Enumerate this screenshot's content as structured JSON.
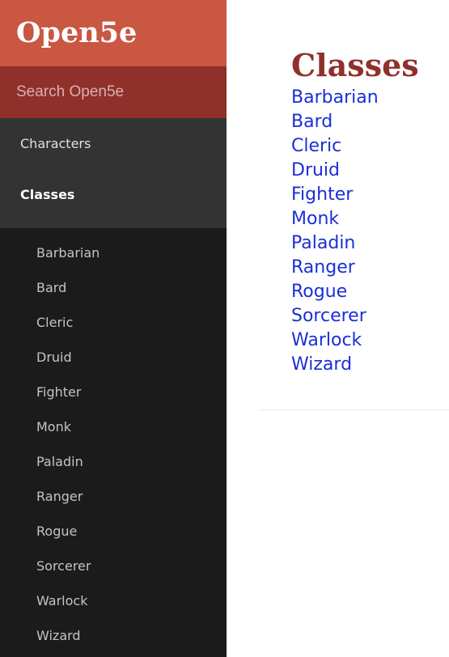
{
  "brand": {
    "title": "Open5e"
  },
  "search": {
    "placeholder": "Search Open5e"
  },
  "nav": {
    "top_items": [
      {
        "label": "Characters"
      },
      {
        "label": "Classes"
      }
    ],
    "sub_items": [
      {
        "label": "Barbarian"
      },
      {
        "label": "Bard"
      },
      {
        "label": "Cleric"
      },
      {
        "label": "Druid"
      },
      {
        "label": "Fighter"
      },
      {
        "label": "Monk"
      },
      {
        "label": "Paladin"
      },
      {
        "label": "Ranger"
      },
      {
        "label": "Rogue"
      },
      {
        "label": "Sorcerer"
      },
      {
        "label": "Warlock"
      },
      {
        "label": "Wizard"
      }
    ]
  },
  "main": {
    "title": "Classes",
    "links": [
      {
        "label": "Barbarian"
      },
      {
        "label": "Bard"
      },
      {
        "label": "Cleric"
      },
      {
        "label": "Druid"
      },
      {
        "label": "Fighter"
      },
      {
        "label": "Monk"
      },
      {
        "label": "Paladin"
      },
      {
        "label": "Ranger"
      },
      {
        "label": "Rogue"
      },
      {
        "label": "Sorcerer"
      },
      {
        "label": "Warlock"
      },
      {
        "label": "Wizard"
      }
    ]
  },
  "colors": {
    "brand_bg": "#c95742",
    "search_bg": "#90302b",
    "nav_bg": "#333333",
    "subnav_bg": "#1b1b1b",
    "title_color": "#90302b",
    "link_color": "#1b2fd6"
  }
}
